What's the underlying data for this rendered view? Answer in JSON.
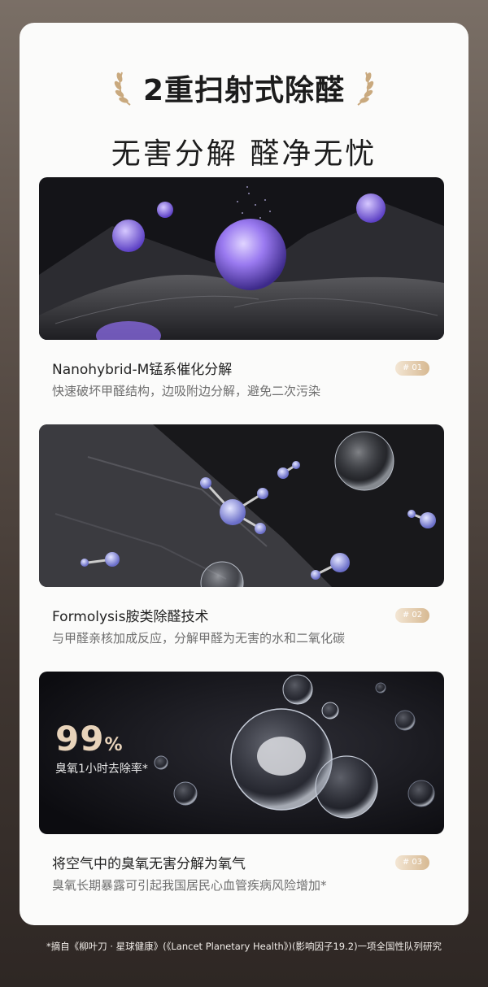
{
  "headline": {
    "line1": "2重扫射式除醛",
    "line2": "无害分解 醛净无忧"
  },
  "features": [
    {
      "title": "Nanohybrid-M锰系催化分解",
      "desc": "快速破坏甲醛结构，边吸附边分解，避免二次污染",
      "badge": "# 01"
    },
    {
      "title": "Formolysis胺类除醛技术",
      "desc": "与甲醛亲核加成反应，分解甲醛为无害的水和二氧化碳",
      "badge": "# 02"
    },
    {
      "title": "将空气中的臭氧无害分解为氧气",
      "desc": "臭氧长期暴露可引起我国居民心血管疾病风险增加*",
      "badge": "# 03"
    }
  ],
  "stat": {
    "value": "99",
    "unit": "%",
    "label": "臭氧1小时去除率*"
  },
  "footnote": "*摘自《柳叶刀 · 星球健康》(《Lancet Planetary Health》)(影响因子19.2)一项全国性队列研究",
  "colors": {
    "card": "#fbfbfa",
    "badge_start": "#f3e6d4",
    "badge_end": "#d7b992",
    "purple": "#8b6be8",
    "stat_gold": "#e8d3ba"
  }
}
